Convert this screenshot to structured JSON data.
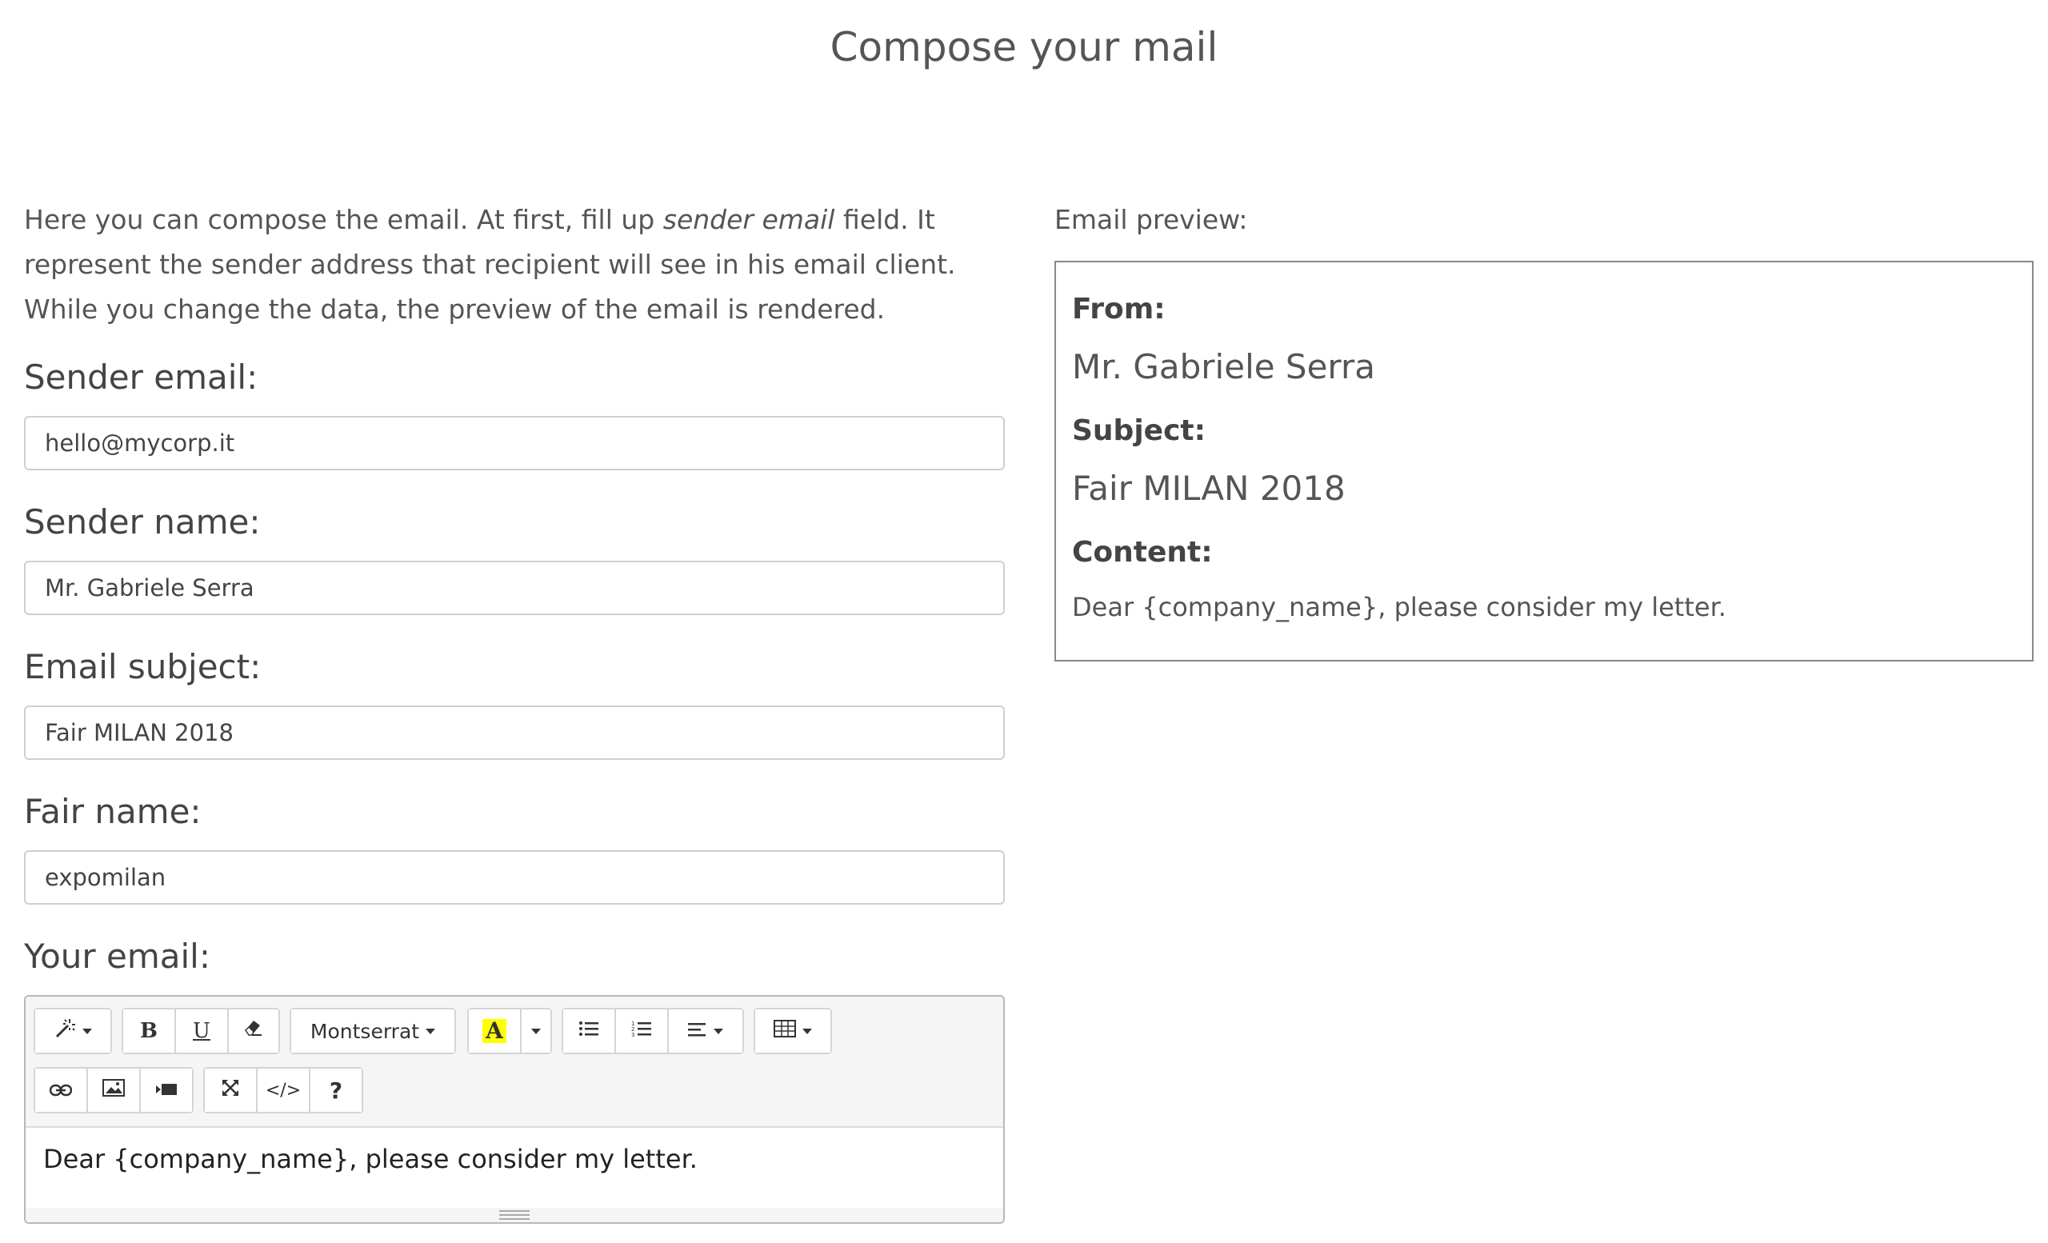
{
  "page": {
    "title": "Compose your mail"
  },
  "intro": {
    "part1": "Here you can compose the email. At first, fill up ",
    "emphasis": "sender email",
    "part2": " field. It represent the sender address that recipient will see in his email client. While you change the data, the preview of the email is rendered."
  },
  "form": {
    "sender_email": {
      "label": "Sender email:",
      "value": "hello@mycorp.it"
    },
    "sender_name": {
      "label": "Sender name:",
      "value": "Mr. Gabriele Serra"
    },
    "email_subject": {
      "label": "Email subject:",
      "value": "Fair MILAN 2018"
    },
    "fair_name": {
      "label": "Fair name:",
      "value": "expomilan"
    },
    "your_email": {
      "label": "Your email:"
    }
  },
  "editor": {
    "font_select": "Montserrat",
    "content": "Dear {company_name}, please consider my letter.",
    "toolbar_icons": [
      "magic-icon",
      "bold-icon",
      "underline-icon",
      "eraser-icon",
      "font-select",
      "highlight-icon",
      "unordered-list-icon",
      "ordered-list-icon",
      "align-icon",
      "table-icon",
      "link-icon",
      "picture-icon",
      "video-icon",
      "fullscreen-icon",
      "code-view-icon",
      "help-icon"
    ],
    "highlight_color": "#ffff00",
    "bold_label": "B",
    "underline_label": "U",
    "code_label": "</>",
    "help_label": "?"
  },
  "preview": {
    "label": "Email preview:",
    "from_label": "From:",
    "from_value": "Mr. Gabriele Serra",
    "subject_label": "Subject:",
    "subject_value": "Fair MILAN 2018",
    "content_label": "Content:",
    "content_value": "Dear {company_name}, please consider my letter."
  }
}
